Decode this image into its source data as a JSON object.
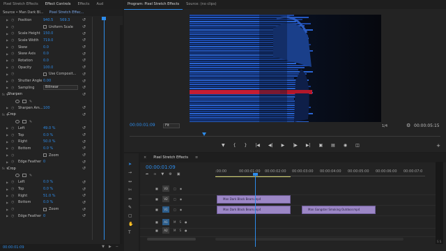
{
  "colors": {
    "accent": "#2d8ceb",
    "clip": "#9c87c6",
    "panel": "#232323"
  },
  "effect_panel": {
    "tabs": [
      "Pixel Stretch Effects",
      "Effect Controls",
      "Effects",
      "Aud"
    ],
    "source_label": "Source • Man Dark Bl...",
    "clip_label": "Pixel Stretch Effec...",
    "rows": [
      {
        "type": "prop",
        "label": "Position",
        "v1": "940.5",
        "v2": "569.3"
      },
      {
        "type": "check",
        "label": "Uniform Scale"
      },
      {
        "type": "prop",
        "label": "Scale Height",
        "v1": "150.0"
      },
      {
        "type": "prop",
        "label": "Scale Width",
        "v1": "719.0"
      },
      {
        "type": "prop",
        "label": "Skew",
        "v1": "0.0"
      },
      {
        "type": "prop",
        "label": "Skew Axis",
        "v1": "0.0"
      },
      {
        "type": "prop",
        "label": "Rotation",
        "v1": "0.0"
      },
      {
        "type": "prop",
        "label": "Opacity",
        "v1": "100.0"
      },
      {
        "type": "check",
        "label": "Use Composit..."
      },
      {
        "type": "prop",
        "label": "Shutter Angle",
        "v1": "0.00"
      },
      {
        "type": "select",
        "label": "Sampling",
        "v1": "Bilinear"
      },
      {
        "type": "header",
        "label": "Sharpen"
      },
      {
        "type": "shapes"
      },
      {
        "type": "prop",
        "label": "Sharpen Am...",
        "v1": "100"
      },
      {
        "type": "header",
        "label": "Crop"
      },
      {
        "type": "shapes"
      },
      {
        "type": "prop",
        "label": "Left",
        "v1": "49.0 %"
      },
      {
        "type": "prop",
        "label": "Top",
        "v1": "0.0 %"
      },
      {
        "type": "prop",
        "label": "Right",
        "v1": "50.0 %"
      },
      {
        "type": "prop",
        "label": "Bottom",
        "v1": "0.0 %"
      },
      {
        "type": "check",
        "label": "Zoom"
      },
      {
        "type": "prop",
        "label": "Edge Feather",
        "v1": "0"
      },
      {
        "type": "header",
        "label": "Crop"
      },
      {
        "type": "shapes"
      },
      {
        "type": "prop",
        "label": "Left",
        "v1": "0.0 %"
      },
      {
        "type": "prop",
        "label": "Top",
        "v1": "0.0 %"
      },
      {
        "type": "prop",
        "label": "Right",
        "v1": "51.0 %"
      },
      {
        "type": "prop",
        "label": "Bottom",
        "v1": "0.0 %"
      },
      {
        "type": "check",
        "label": "Zoom"
      },
      {
        "type": "prop",
        "label": "Edge Feather",
        "v1": "0"
      }
    ],
    "timecode": "00:00:01:09"
  },
  "program": {
    "tabs": [
      "Program: Pixel Stretch Effects",
      "Source: (no clips)"
    ],
    "timecode": "00:00:01:09",
    "fit": "Fit",
    "quality": "1/4",
    "duration": "00:00:05:15"
  },
  "timeline": {
    "title": "Pixel Stretch Effects",
    "timecode": "00:00:01:09",
    "ruler": [
      ":00:00",
      "00:00:01:00",
      "00:00:02:00",
      "00:00:03:00",
      "00:00:04:00",
      "00:00:05:00",
      "00:00:06:00",
      "00:00:07:0"
    ],
    "tracks": [
      {
        "name": "V3",
        "kind": "video"
      },
      {
        "name": "V2",
        "kind": "video"
      },
      {
        "name": "V1",
        "kind": "video",
        "on": true
      },
      {
        "name": "A1",
        "kind": "audio",
        "on": true
      },
      {
        "name": "A2",
        "kind": "audio"
      }
    ],
    "clips": [
      {
        "label": "Man Dark Black Beam.mp4",
        "track": "V2"
      },
      {
        "label": "Man Dark Black Beam.mp4",
        "track": "V1"
      },
      {
        "label": "Man Gangster Smoking Outdoor.mp4",
        "track": "V1"
      }
    ]
  }
}
